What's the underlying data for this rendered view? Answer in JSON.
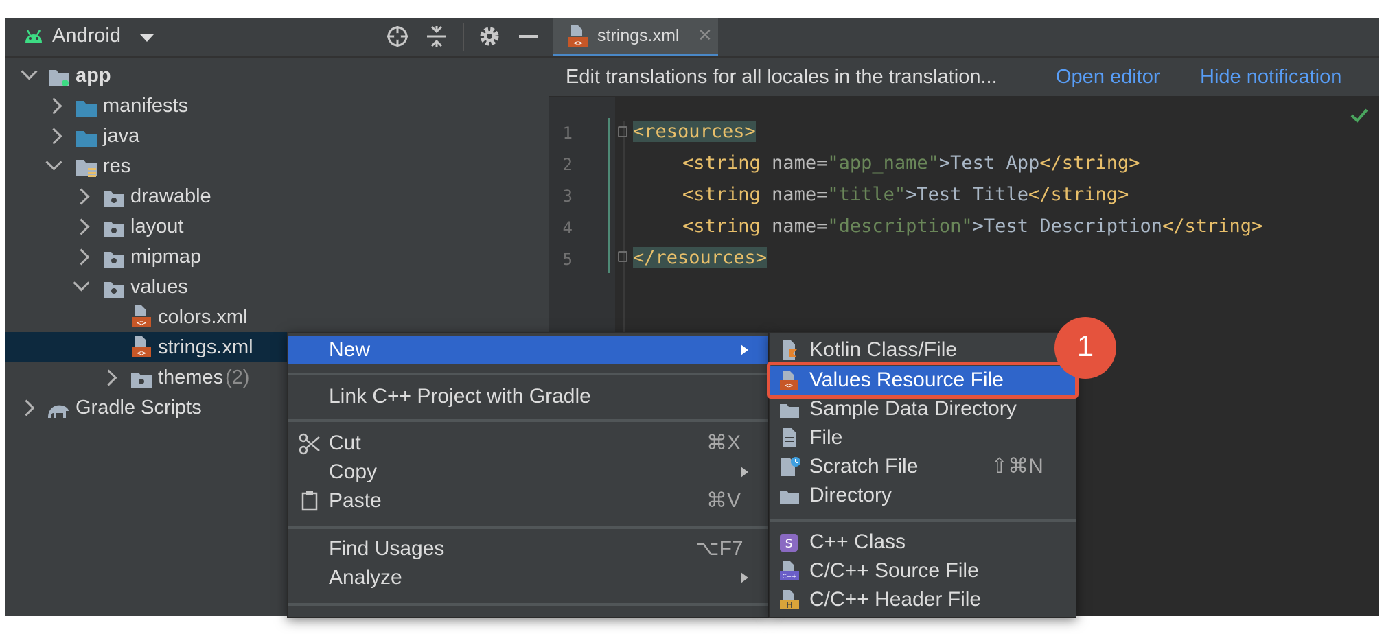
{
  "project": {
    "view_name": "Android",
    "tree": [
      {
        "label": "app"
      },
      {
        "label": "manifests"
      },
      {
        "label": "java"
      },
      {
        "label": "res"
      },
      {
        "label": "drawable"
      },
      {
        "label": "layout"
      },
      {
        "label": "mipmap"
      },
      {
        "label": "values"
      },
      {
        "label": "colors.xml"
      },
      {
        "label": "strings.xml"
      },
      {
        "label": "themes",
        "count": "(2)"
      },
      {
        "label": "Gradle Scripts"
      }
    ]
  },
  "editor": {
    "tab_label": "strings.xml",
    "notification": {
      "text": "Edit translations for all locales in the translation...",
      "open_editor": "Open editor",
      "hide": "Hide notification"
    },
    "line_numbers": [
      "1",
      "2",
      "3",
      "4",
      "5"
    ],
    "code": {
      "l1": "<resources>",
      "l2_open": "<string",
      "l2_attr": " name=",
      "l2_val": "\"app_name\"",
      "l2_text": ">Test App",
      "l2_close": "</string>",
      "l3_open": "<string",
      "l3_attr": " name=",
      "l3_val": "\"title\"",
      "l3_text": ">Test Title",
      "l3_close": "</string>",
      "l4_open": "<string",
      "l4_attr": " name=",
      "l4_val": "\"description\"",
      "l4_text": ">Test Description",
      "l4_close": "</string>",
      "l5": "</resources>"
    }
  },
  "context_menu": {
    "new": "New",
    "link_cpp": "Link C++ Project with Gradle",
    "cut": "Cut",
    "cut_shortcut": "⌘X",
    "copy": "Copy",
    "paste": "Paste",
    "paste_shortcut": "⌘V",
    "find_usages": "Find Usages",
    "find_usages_shortcut": "⌥F7",
    "analyze": "Analyze"
  },
  "submenu": {
    "kotlin": "Kotlin Class/File",
    "values_resource": "Values Resource File",
    "sample_data": "Sample Data Directory",
    "file": "File",
    "scratch": "Scratch File",
    "scratch_shortcut": "⇧⌘N",
    "directory": "Directory",
    "cpp_class": "C++ Class",
    "cpp_source": "C/C++ Source File",
    "cpp_header": "C/C++ Header File"
  },
  "callout": {
    "number": "1",
    "color": "#e5533d"
  },
  "colors": {
    "selection": "#2f65ca",
    "link": "#589df6",
    "android_green": "#3ddc84"
  }
}
